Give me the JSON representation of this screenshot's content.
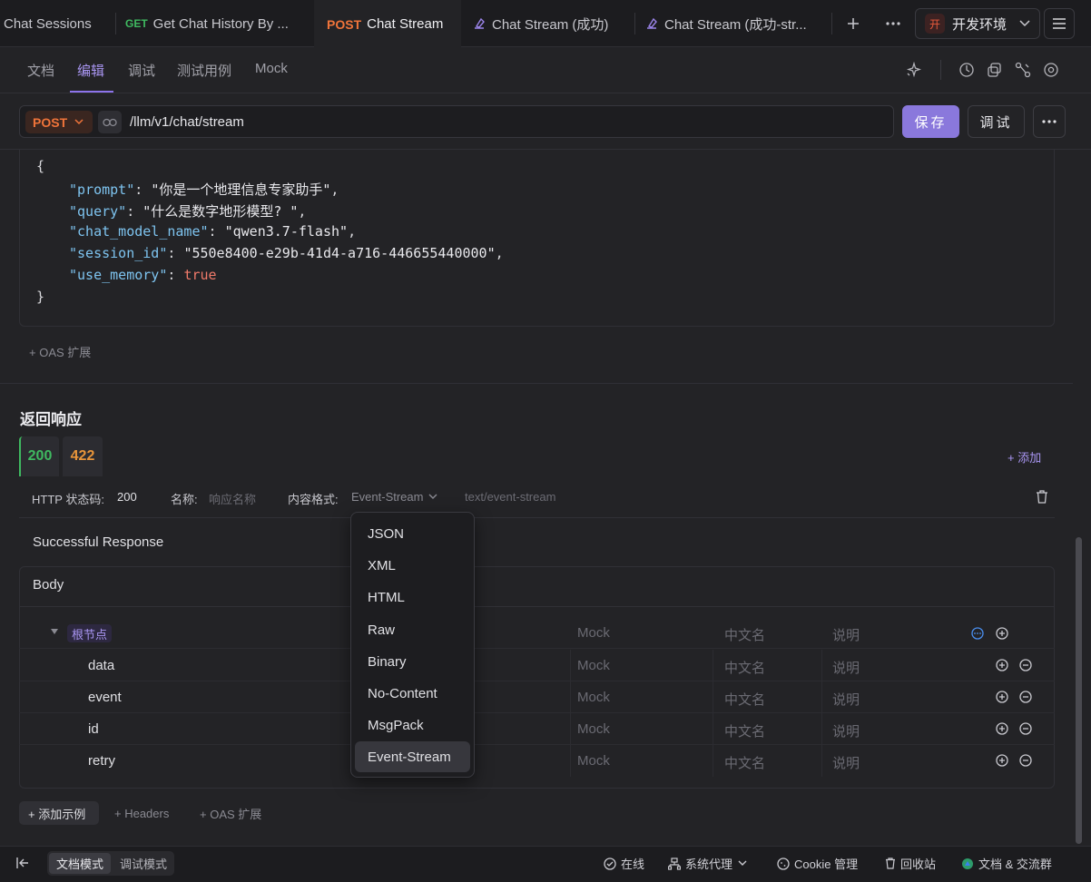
{
  "tabs": [
    {
      "label": "Chat Sessions",
      "method": ""
    },
    {
      "label": "Get Chat History By ...",
      "method": "GET"
    },
    {
      "label": "Chat Stream",
      "method": "POST"
    },
    {
      "label": "Chat Stream (成功)",
      "method": ""
    },
    {
      "label": "Chat Stream (成功-str...",
      "method": ""
    }
  ],
  "env": {
    "badge": "开",
    "label": "开发环境"
  },
  "subtabs": [
    "文档",
    "编辑",
    "调试",
    "测试用例",
    "Mock"
  ],
  "request": {
    "method": "POST",
    "url": "/llm/v1/chat/stream",
    "save": "保存",
    "debug": "调试"
  },
  "body_json": {
    "open": "{",
    "close": "}",
    "lines": [
      {
        "key": "\"prompt\"",
        "val": "\"你是一个地理信息专家助手\"",
        "comma": ","
      },
      {
        "key": "\"query\"",
        "val": "\"什么是数字地形模型? \"",
        "comma": ","
      },
      {
        "key": "\"chat_model_name\"",
        "val": "\"qwen3.7-flash\"",
        "comma": ","
      },
      {
        "key": "\"session_id\"",
        "val": "\"550e8400-e29b-41d4-a716-446655440000\"",
        "comma": ","
      },
      {
        "key": "\"use_memory\"",
        "val": "true",
        "comma": ""
      }
    ]
  },
  "oas_ext": "+ OAS 扩展",
  "response": {
    "title": "返回响应",
    "codes": [
      "200",
      "422"
    ],
    "add": "+ 添加",
    "status_label": "HTTP 状态码:",
    "status_value": "200",
    "name_label": "名称:",
    "name_placeholder": "响应名称",
    "format_label": "内容格式:",
    "format_value": "Event-Stream",
    "content_type": "text/event-stream",
    "description": "Successful Response",
    "body_label": "Body",
    "root_label": "根节点",
    "col_mock": "Mock",
    "col_cn": "中文名",
    "col_desc": "说明",
    "fields": [
      "data",
      "event",
      "id",
      "retry"
    ]
  },
  "format_options": [
    "JSON",
    "XML",
    "HTML",
    "Raw",
    "Binary",
    "No-Content",
    "MsgPack",
    "Event-Stream"
  ],
  "footer_actions": {
    "add_example": "+ 添加示例",
    "headers": "+ Headers",
    "oas": "+ OAS 扩展"
  },
  "statusbar": {
    "mode_doc": "文档模式",
    "mode_debug": "调试模式",
    "online": "在线",
    "proxy": "系统代理",
    "cookie": "Cookie 管理",
    "recycle": "回收站",
    "docs": "文档 & 交流群"
  }
}
